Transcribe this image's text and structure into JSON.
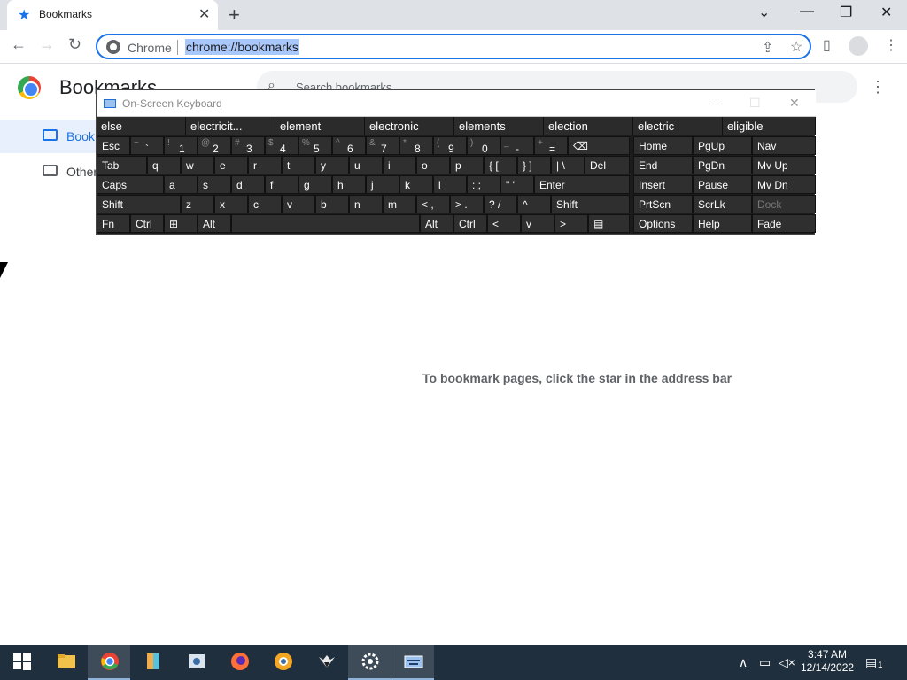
{
  "browser": {
    "tab_title": "Bookmarks",
    "omnibox_label": "Chrome",
    "url": "chrome://bookmarks"
  },
  "bookmarks": {
    "title": "Bookmarks",
    "search_placeholder": "Search bookmarks",
    "sidebar": [
      {
        "label": "Book",
        "selected": true
      },
      {
        "label": "Other",
        "selected": false
      }
    ],
    "empty_message": "To bookmark pages, click the star in the address bar"
  },
  "osk": {
    "title": "On-Screen Keyboard",
    "predictions": [
      "else",
      "electricit...",
      "element",
      "electronic",
      "elements",
      "election",
      "electric",
      "eligible"
    ],
    "rows": {
      "row1": [
        {
          "label": "Esc"
        },
        {
          "shift": "~",
          "main": "`"
        },
        {
          "shift": "!",
          "main": "1"
        },
        {
          "shift": "@",
          "main": "2"
        },
        {
          "shift": "#",
          "main": "3"
        },
        {
          "shift": "$",
          "main": "4"
        },
        {
          "shift": "%",
          "main": "5"
        },
        {
          "shift": "^",
          "main": "6"
        },
        {
          "shift": "&",
          "main": "7"
        },
        {
          "shift": "*",
          "main": "8"
        },
        {
          "shift": "(",
          "main": "9"
        },
        {
          "shift": ")",
          "main": "0"
        },
        {
          "shift": "_",
          "main": "-"
        },
        {
          "shift": "+",
          "main": "="
        },
        {
          "label": "⌫"
        }
      ],
      "row2": [
        "Tab",
        "q",
        "w",
        "e",
        "r",
        "t",
        "y",
        "u",
        "i",
        "o",
        "p",
        "{ [",
        "} ]",
        "| \\",
        "Del"
      ],
      "row3": [
        "Caps",
        "a",
        "s",
        "d",
        "f",
        "g",
        "h",
        "j",
        "k",
        "l",
        ": ;",
        "\" '",
        "Enter"
      ],
      "row4": [
        "Shift",
        "z",
        "x",
        "c",
        "v",
        "b",
        "n",
        "m",
        "< ,",
        "> .",
        "? /",
        "^",
        "Shift"
      ],
      "row5": [
        "Fn",
        "Ctrl",
        "⊞",
        "Alt",
        "",
        "Alt",
        "Ctrl",
        "<",
        "v",
        ">",
        "▤"
      ]
    },
    "nav": [
      [
        "Home",
        "PgUp",
        "Nav"
      ],
      [
        "End",
        "PgDn",
        "Mv Up"
      ],
      [
        "Insert",
        "Pause",
        "Mv Dn"
      ],
      [
        "PrtScn",
        "ScrLk",
        "Dock"
      ],
      [
        "Options",
        "Help",
        "Fade"
      ]
    ]
  },
  "taskbar": {
    "time": "3:47 AM",
    "date": "12/14/2022",
    "notification_count": "1"
  }
}
